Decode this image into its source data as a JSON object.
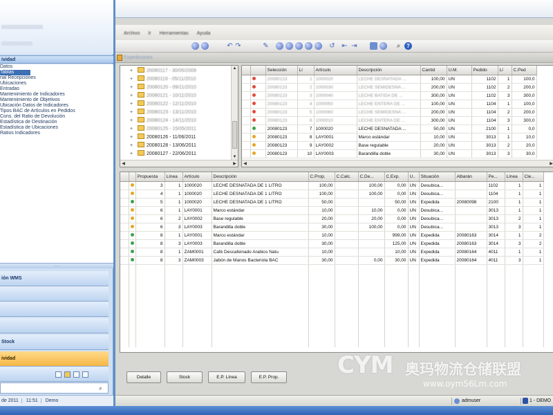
{
  "sidebar": {
    "section_title": "ividad",
    "items": [
      {
        "label": "Datos",
        "selected": false
      },
      {
        "label": "Tablas",
        "selected": true
      },
      {
        "label": "rial Recepciones",
        "selected": false
      },
      {
        "label": "Ubicaciones",
        "selected": false
      },
      {
        "label": "Entradas",
        "selected": false
      },
      {
        "label": "Mantenimiento de Indicadores",
        "selected": false
      },
      {
        "label": "Mantenimiento de Objetivos",
        "selected": false
      },
      {
        "label": "Ubicación Datos de Indicadores",
        "selected": false
      },
      {
        "label": "Tipos BAC de Artículos en Pedidos",
        "selected": false
      },
      {
        "label": "Cons. del Ratio de Devolución",
        "selected": false
      },
      {
        "label": "Estadística de Destinación",
        "selected": false
      },
      {
        "label": "Estadística de Ubicaciones",
        "selected": false
      },
      {
        "label": "Ratios Indicadores",
        "selected": false
      }
    ],
    "splitter": "....",
    "nav_buttons": [
      {
        "label": "ión WMS",
        "active": false
      },
      {
        "label": "",
        "active": false
      },
      {
        "label": "",
        "active": false
      },
      {
        "label": "",
        "active": false
      },
      {
        "label": "Stock",
        "active": false
      },
      {
        "label": "ividad",
        "active": true
      }
    ],
    "status": [
      "de 2011",
      "11:51",
      "Demo"
    ]
  },
  "window": {
    "menu": [
      "Archivo",
      "Ir",
      "Herramientas",
      "Ayuda"
    ],
    "subtitle": "Expediciones"
  },
  "tree": {
    "items": [
      {
        "label": "20080117 - 30/05/2009",
        "blurred": true
      },
      {
        "label": "20080119 - 05/11/2010",
        "blurred": true
      },
      {
        "label": "20080120 - 09/11/2010",
        "blurred": true
      },
      {
        "label": "20080121 - 10/11/2010",
        "blurred": true
      },
      {
        "label": "20080122 - 12/11/2010",
        "blurred": true
      },
      {
        "label": "20080123 - 13/11/2010",
        "blurred": true
      },
      {
        "label": "20080124 - 14/11/2010",
        "blurred": true
      },
      {
        "label": "20080125 - 15/05/2011",
        "blurred": true
      },
      {
        "label": "20080126 - 11/06/2011",
        "blurred": false
      },
      {
        "label": "20080128 - 13/06/2011",
        "blurred": false
      },
      {
        "label": "20080127 - 22/06/2011",
        "blurred": false
      }
    ]
  },
  "top_grid": {
    "columns": [
      "",
      "Selección",
      "Lí",
      "Artículo",
      "Descripción",
      "Cantid",
      "U.M.",
      "Pedido",
      "Lí",
      "C.Ped"
    ],
    "rows": [
      {
        "dot": "#e04a3c",
        "cells": [
          "20080123",
          "1",
          "1000020",
          "LECHE DESNATADA ...",
          "100,00",
          "UN",
          "1102",
          "1",
          "100,0"
        ],
        "blurred": true
      },
      {
        "dot": "#e04a3c",
        "cells": [
          "20080123",
          "2",
          "1000030",
          "LECHE SEMIDESNA ...",
          "200,00",
          "UN",
          "1102",
          "2",
          "200,0"
        ],
        "blurred": true
      },
      {
        "dot": "#e04a3c",
        "cells": [
          "20080123",
          "3",
          "1000040",
          "LECHE BATIDA DE ...",
          "300,00",
          "UN",
          "1102",
          "3",
          "300,0"
        ],
        "blurred": true
      },
      {
        "dot": "#e04a3c",
        "cells": [
          "20080123",
          "4",
          "1000050",
          "LECHE ENTERA DE ...",
          "100,00",
          "UN",
          "1104",
          "1",
          "100,0"
        ],
        "blurred": true
      },
      {
        "dot": "#e04a3c",
        "cells": [
          "20080123",
          "5",
          "1000060",
          "LECHE SEMIDESNA ...",
          "200,00",
          "UN",
          "1104",
          "2",
          "200,0"
        ],
        "blurred": true
      },
      {
        "dot": "#e04a3c",
        "cells": [
          "20080123",
          "6",
          "1000010",
          "LECHE ENTERA DE ...",
          "300,00",
          "UN",
          "1104",
          "3",
          "300,0"
        ],
        "blurred": true
      },
      {
        "dot": "#3aa24a",
        "cells": [
          "20080123",
          "7",
          "1000020",
          "LECHE DESNATADA ...",
          "50,00",
          "UN",
          "2100",
          "1",
          "0,0"
        ],
        "blurred": false
      },
      {
        "dot": "#e6a623",
        "cells": [
          "20080123",
          "8",
          "LAY0001",
          "Marco estándar",
          "10,00",
          "UN",
          "3013",
          "1",
          "10,0"
        ],
        "blurred": false
      },
      {
        "dot": "#e6a623",
        "cells": [
          "20080123",
          "9",
          "LAY0002",
          "Base regulable",
          "20,00",
          "UN",
          "3013",
          "2",
          "20,0"
        ],
        "blurred": false
      },
      {
        "dot": "#e6a623",
        "cells": [
          "20080123",
          "10",
          "LAY0003",
          "Barandilla doble",
          "30,00",
          "UN",
          "3013",
          "3",
          "30,0"
        ],
        "blurred": false
      }
    ]
  },
  "bottom_grid": {
    "columns": [
      "",
      "Propuesta",
      "Línea",
      "Artículo",
      "Descripción",
      "C.Prop.",
      "C.Calc.",
      "C.De...",
      "C.Exp.",
      "U..",
      "Situación",
      "Albarán",
      "Pe...",
      "Línea",
      "Cle..."
    ],
    "rows": [
      {
        "dot": "#e6a623",
        "cells": [
          "3",
          "1",
          "1000020",
          "LECHE DESNATADA DE 1 LITRO",
          "100,00",
          "",
          "100,00",
          "0,00",
          "UN",
          "Desubica...",
          "",
          "1102",
          "1",
          "1"
        ]
      },
      {
        "dot": "#e6a623",
        "cells": [
          "4",
          "1",
          "1000020",
          "LECHE DESNATADA DE 1 LITRO",
          "100,00",
          "",
          "100,00",
          "0,00",
          "UN",
          "Desubica...",
          "",
          "1104",
          "1",
          "1"
        ]
      },
      {
        "dot": "#3aa24a",
        "cells": [
          "5",
          "1",
          "1000020",
          "LECHE DESNATADA DE 1 LITRO",
          "50,00",
          "",
          "",
          "50,00",
          "UN",
          "Expedida",
          "20080098",
          "2100",
          "1",
          "1"
        ]
      },
      {
        "dot": "#e6a623",
        "cells": [
          "6",
          "1",
          "LAY0001",
          "Marco estándar",
          "10,00",
          "",
          "10,00",
          "0,00",
          "UN",
          "Desubica...",
          "",
          "3013",
          "1",
          "1"
        ]
      },
      {
        "dot": "#e6a623",
        "cells": [
          "6",
          "2",
          "LAY0002",
          "Base regulable",
          "20,00",
          "",
          "20,00",
          "0,00",
          "UN",
          "Desubica...",
          "",
          "3013",
          "2",
          "1"
        ]
      },
      {
        "dot": "#e6a623",
        "cells": [
          "6",
          "3",
          "LAY0003",
          "Barandilla doble",
          "30,00",
          "",
          "100,00",
          "0,00",
          "UN",
          "Desubica...",
          "",
          "3013",
          "3",
          "1"
        ]
      },
      {
        "dot": "#3aa24a",
        "cells": [
          "8",
          "1",
          "LAY0001",
          "Marco estándar",
          "10,00",
          "",
          "",
          "999,00",
          "UN",
          "Expedida",
          "20080163",
          "3014",
          "1",
          "2"
        ]
      },
      {
        "dot": "#3aa24a",
        "cells": [
          "8",
          "3",
          "LAY0003",
          "Barandilla doble",
          "30,00",
          "",
          "",
          "125,00",
          "UN",
          "Expedida",
          "20080163",
          "3014",
          "3",
          "2"
        ]
      },
      {
        "dot": "#3aa24a",
        "cells": [
          "8",
          "1",
          "ZAM0001",
          "Café Descafeinado Arabico Natu",
          "10,00",
          "",
          "",
          "10,00",
          "UN",
          "Expedida",
          "20080164",
          "4011",
          "1",
          "1"
        ]
      },
      {
        "dot": "#3aa24a",
        "cells": [
          "8",
          "3",
          "ZAM0003",
          "Jabón de Manos Bacteriola BAC",
          "30,00",
          "",
          "0,00",
          "30,00",
          "UN",
          "Expedida",
          "20080164",
          "4011",
          "3",
          "1"
        ]
      }
    ]
  },
  "buttons": [
    "Detalle",
    "Stock",
    "E.P. Línea",
    "E.P. Prop."
  ],
  "statusbar": {
    "user": "admuser",
    "company": "1 - DEMO"
  },
  "watermark": {
    "logo": "CYM",
    "text": "奥玛物流仓储联盟",
    "url": "www.oym56Lm.com"
  }
}
